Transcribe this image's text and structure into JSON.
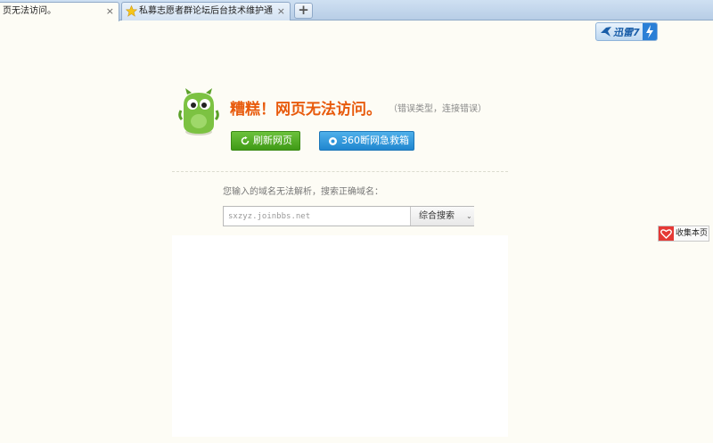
{
  "tabs": [
    {
      "label": "页无法访问。",
      "close": "×",
      "active": true
    },
    {
      "label": "私募志愿者群论坛后台技术维护通知...",
      "close": "×",
      "active": false
    }
  ],
  "new_tab": "+",
  "xunlei": {
    "label": "迅雷7"
  },
  "error": {
    "title": "糟糕！网页无法访问。",
    "detail": "（错误类型，连接错误）"
  },
  "buttons": {
    "refresh": "刷新网页",
    "rescue": "360断网急救箱"
  },
  "hint": "您输入的域名无法解析，搜索正确域名：",
  "search": {
    "value": "sxzyz.joinbbs.net",
    "select": "综合搜索",
    "arrow": "⌄"
  },
  "bookmark": {
    "label": "收集本页"
  },
  "colors": {
    "title": "#e85a0c",
    "refresh_btn": "#4ea823",
    "rescue_btn": "#2b93da",
    "bookmark_icon": "#e53935"
  }
}
